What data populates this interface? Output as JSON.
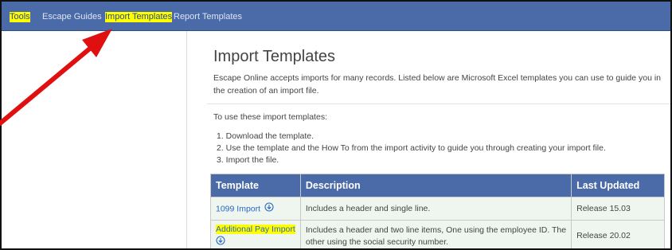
{
  "nav": {
    "items": [
      {
        "label": "Tools",
        "highlighted": true
      },
      {
        "label": "Escape Guides",
        "highlighted": false
      },
      {
        "label": "Import Templates",
        "highlighted": true
      },
      {
        "label": "Report Templates",
        "highlighted": false
      }
    ]
  },
  "page": {
    "title": "Import Templates",
    "intro": "Escape Online accepts imports for many records. Listed below are Microsoft Excel templates you can use to guide you in the creation of an import file.",
    "howto_label": "To use these import templates:",
    "steps": [
      "1. Download the template.",
      "2. Use the template and the How To from the import activity to guide you through creating your import file.",
      "3. Import the file."
    ]
  },
  "table": {
    "headers": [
      "Template",
      "Description",
      "Last Updated"
    ],
    "rows": [
      {
        "template": "1099 Import",
        "description": "Includes a header and single line.",
        "updated": "Release 15.03",
        "icon": "download-icon"
      },
      {
        "template": "Additional Pay Import",
        "description": "Includes a header and two line items, One using the employee ID. The other using the social security number.",
        "updated": "Release 20.02",
        "icon": "download-icon"
      }
    ]
  },
  "colors": {
    "nav_bg": "#4a6ba8",
    "highlight": "#ffff00",
    "table_header_bg": "#4a6ba8",
    "row_bg": "#eef6ef",
    "link": "#2c67c4",
    "annotation_arrow": "#e01010"
  }
}
